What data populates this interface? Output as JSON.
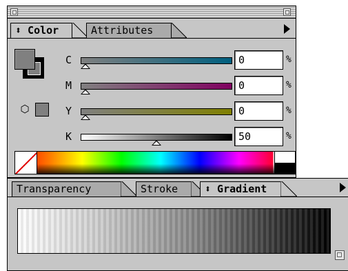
{
  "color_panel": {
    "tabs": [
      {
        "label": "⬍ Color",
        "active": true
      },
      {
        "label": "Attributes",
        "active": false
      }
    ],
    "channels": [
      {
        "label": "C",
        "value": "0",
        "unit": "%",
        "color_start": "#808080",
        "color_end": "#006080"
      },
      {
        "label": "M",
        "value": "0",
        "unit": "%",
        "color_start": "#808080",
        "color_end": "#800060"
      },
      {
        "label": "Y",
        "value": "0",
        "unit": "%",
        "color_start": "#808080",
        "color_end": "#808000"
      },
      {
        "label": "K",
        "value": "50",
        "unit": "%",
        "color_start": "#ffffff",
        "color_end": "#000000"
      }
    ],
    "fill_color": "#808080",
    "stroke_color": "#000000"
  },
  "gradient_panel": {
    "tabs": [
      {
        "label": "Transparency",
        "active": false
      },
      {
        "label": "Stroke",
        "active": false
      },
      {
        "label": "⬍ Gradient",
        "active": true
      }
    ],
    "gradient_start": "#ffffff",
    "gradient_end": "#000000"
  },
  "icons": {
    "panel_menu": "triangle-right",
    "gamut_warning": "cube",
    "none_swatch": "slash"
  }
}
